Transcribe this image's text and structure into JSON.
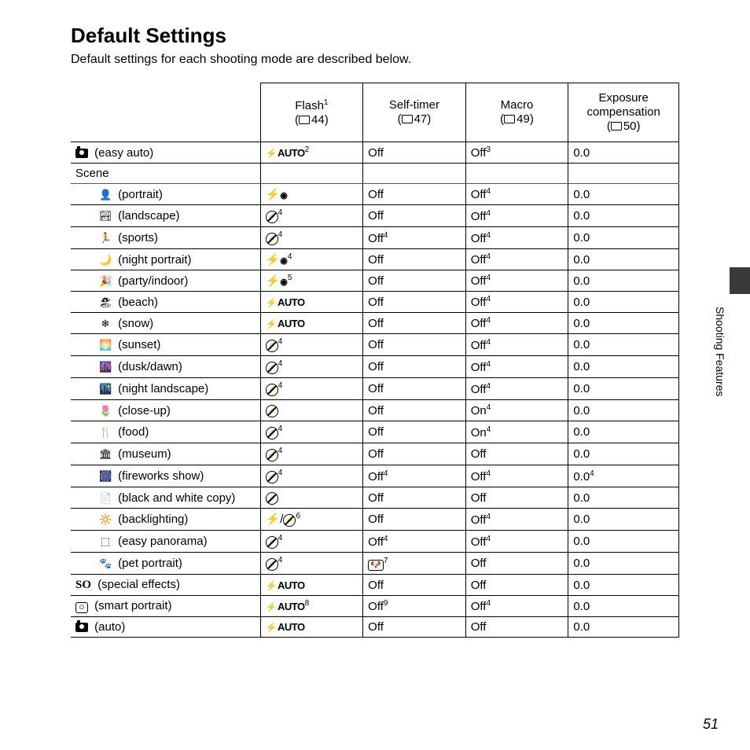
{
  "title": "Default Settings",
  "intro": "Default settings for each shooting mode are described below.",
  "section_label": "Shooting Features",
  "page_number": "51",
  "columns": [
    {
      "title": "Flash",
      "sup": "1",
      "page": "44"
    },
    {
      "title": "Self-timer",
      "sup": "",
      "page": "47"
    },
    {
      "title": "Macro",
      "sup": "",
      "page": "49"
    },
    {
      "title": "Exposure compensation",
      "sup": "",
      "page": "50"
    }
  ],
  "scene_label": "Scene",
  "rows_top": [
    {
      "icon": "camera-heart",
      "label": "(easy auto)",
      "flash": {
        "kind": "auto",
        "sup": "2"
      },
      "selftimer": {
        "text": "Off"
      },
      "macro": {
        "text": "Off",
        "sup": "3"
      },
      "exp": {
        "text": "0.0"
      }
    }
  ],
  "rows_scene": [
    {
      "icon": "portrait",
      "label": "(portrait)",
      "flash": {
        "kind": "redeye"
      },
      "selftimer": {
        "text": "Off"
      },
      "macro": {
        "text": "Off",
        "sup": "4"
      },
      "exp": {
        "text": "0.0"
      }
    },
    {
      "icon": "landscape",
      "label": "(landscape)",
      "flash": {
        "kind": "noflash",
        "sup": "4"
      },
      "selftimer": {
        "text": "Off"
      },
      "macro": {
        "text": "Off",
        "sup": "4"
      },
      "exp": {
        "text": "0.0"
      }
    },
    {
      "icon": "sports",
      "label": "(sports)",
      "flash": {
        "kind": "noflash",
        "sup": "4"
      },
      "selftimer": {
        "text": "Off",
        "sup": "4"
      },
      "macro": {
        "text": "Off",
        "sup": "4"
      },
      "exp": {
        "text": "0.0"
      }
    },
    {
      "icon": "night-portrait",
      "label": "(night portrait)",
      "flash": {
        "kind": "redeye",
        "sup": "4"
      },
      "selftimer": {
        "text": "Off"
      },
      "macro": {
        "text": "Off",
        "sup": "4"
      },
      "exp": {
        "text": "0.0"
      }
    },
    {
      "icon": "party",
      "label": "(party/indoor)",
      "flash": {
        "kind": "redeye",
        "sup": "5"
      },
      "selftimer": {
        "text": "Off"
      },
      "macro": {
        "text": "Off",
        "sup": "4"
      },
      "exp": {
        "text": "0.0"
      }
    },
    {
      "icon": "beach",
      "label": "(beach)",
      "flash": {
        "kind": "auto"
      },
      "selftimer": {
        "text": "Off"
      },
      "macro": {
        "text": "Off",
        "sup": "4"
      },
      "exp": {
        "text": "0.0"
      }
    },
    {
      "icon": "snow",
      "label": "(snow)",
      "flash": {
        "kind": "auto"
      },
      "selftimer": {
        "text": "Off"
      },
      "macro": {
        "text": "Off",
        "sup": "4"
      },
      "exp": {
        "text": "0.0"
      }
    },
    {
      "icon": "sunset",
      "label": "(sunset)",
      "flash": {
        "kind": "noflash",
        "sup": "4"
      },
      "selftimer": {
        "text": "Off"
      },
      "macro": {
        "text": "Off",
        "sup": "4"
      },
      "exp": {
        "text": "0.0"
      }
    },
    {
      "icon": "dusk",
      "label": "(dusk/dawn)",
      "flash": {
        "kind": "noflash",
        "sup": "4"
      },
      "selftimer": {
        "text": "Off"
      },
      "macro": {
        "text": "Off",
        "sup": "4"
      },
      "exp": {
        "text": "0.0"
      }
    },
    {
      "icon": "night-landscape",
      "label": "(night landscape)",
      "flash": {
        "kind": "noflash",
        "sup": "4"
      },
      "selftimer": {
        "text": "Off"
      },
      "macro": {
        "text": "Off",
        "sup": "4"
      },
      "exp": {
        "text": "0.0"
      }
    },
    {
      "icon": "closeup",
      "label": "(close-up)",
      "flash": {
        "kind": "noflash"
      },
      "selftimer": {
        "text": "Off"
      },
      "macro": {
        "text": "On",
        "sup": "4"
      },
      "exp": {
        "text": "0.0"
      }
    },
    {
      "icon": "food",
      "label": "(food)",
      "flash": {
        "kind": "noflash",
        "sup": "4"
      },
      "selftimer": {
        "text": "Off"
      },
      "macro": {
        "text": "On",
        "sup": "4"
      },
      "exp": {
        "text": "0.0"
      }
    },
    {
      "icon": "museum",
      "label": "(museum)",
      "flash": {
        "kind": "noflash",
        "sup": "4"
      },
      "selftimer": {
        "text": "Off"
      },
      "macro": {
        "text": "Off"
      },
      "exp": {
        "text": "0.0"
      }
    },
    {
      "icon": "fireworks",
      "label": "(fireworks show)",
      "flash": {
        "kind": "noflash",
        "sup": "4"
      },
      "selftimer": {
        "text": "Off",
        "sup": "4"
      },
      "macro": {
        "text": "Off",
        "sup": "4"
      },
      "exp": {
        "text": "0.0",
        "sup": "4"
      }
    },
    {
      "icon": "bwcopy",
      "label": "(black and white copy)",
      "flash": {
        "kind": "noflash"
      },
      "selftimer": {
        "text": "Off"
      },
      "macro": {
        "text": "Off"
      },
      "exp": {
        "text": "0.0"
      }
    },
    {
      "icon": "backlight",
      "label": "(backlighting)",
      "flash": {
        "kind": "flash-or-off",
        "sup": "6"
      },
      "selftimer": {
        "text": "Off"
      },
      "macro": {
        "text": "Off",
        "sup": "4"
      },
      "exp": {
        "text": "0.0"
      }
    },
    {
      "icon": "panorama",
      "label": "(easy panorama)",
      "flash": {
        "kind": "noflash",
        "sup": "4"
      },
      "selftimer": {
        "text": "Off",
        "sup": "4"
      },
      "macro": {
        "text": "Off",
        "sup": "4"
      },
      "exp": {
        "text": "0.0"
      }
    },
    {
      "icon": "pet",
      "label": "(pet portrait)",
      "flash": {
        "kind": "noflash",
        "sup": "4"
      },
      "selftimer": {
        "kind": "pet",
        "sup": "7"
      },
      "macro": {
        "text": "Off"
      },
      "exp": {
        "text": "0.0"
      }
    }
  ],
  "rows_bottom": [
    {
      "icon": "so",
      "label": "(special effects)",
      "flash": {
        "kind": "auto"
      },
      "selftimer": {
        "text": "Off"
      },
      "macro": {
        "text": "Off"
      },
      "exp": {
        "text": "0.0"
      }
    },
    {
      "icon": "smart-portrait",
      "label": "(smart portrait)",
      "flash": {
        "kind": "auto",
        "sup": "8"
      },
      "selftimer": {
        "text": "Off",
        "sup": "9"
      },
      "macro": {
        "text": "Off",
        "sup": "4"
      },
      "exp": {
        "text": "0.0"
      }
    },
    {
      "icon": "auto-camera",
      "label": "(auto)",
      "flash": {
        "kind": "auto"
      },
      "selftimer": {
        "text": "Off"
      },
      "macro": {
        "text": "Off"
      },
      "exp": {
        "text": "0.0"
      }
    }
  ]
}
